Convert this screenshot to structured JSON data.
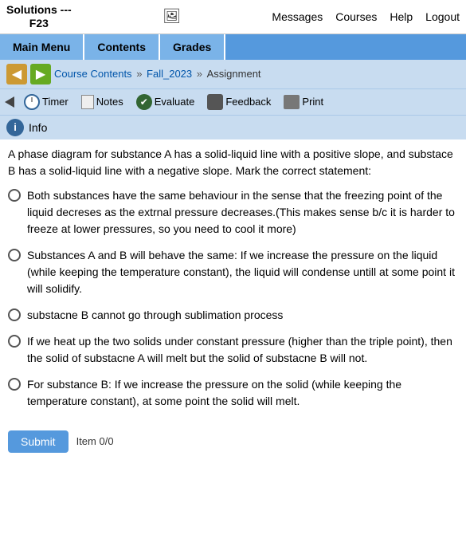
{
  "topnav": {
    "logo": "Solutions ---\nF23",
    "links": [
      "Messages",
      "Courses",
      "Help",
      "Logout"
    ]
  },
  "menubar": {
    "items": [
      "Main Menu",
      "Contents",
      "Grades"
    ]
  },
  "breadcrumb": {
    "back_label": "◄",
    "fwd_label": "►",
    "parts": [
      "Course Contents",
      "Fall_2023",
      "Assignment"
    ],
    "separators": [
      "»",
      "»"
    ]
  },
  "toolbar": {
    "triangle": "◄",
    "timer_label": "Timer",
    "notes_label": "Notes",
    "evaluate_label": "Evaluate",
    "feedback_label": "Feedback",
    "print_label": "Print"
  },
  "info": {
    "label": "Info"
  },
  "question": {
    "text": "A phase diagram for substance A has a solid-liquid line with a positive slope, and substace B has a solid-liquid line with a negative slope. Mark the correct statement:",
    "options": [
      "Both substances have the same behaviour in the sense that the freezing point of the liquid decreses as the extrnal pressure decreases.(This makes sense b/c it is harder to freeze at lower pressures, so you need to cool it more)",
      "Substances A and B will behave the same: If we increase the pressure on the liquid (while keeping the temperature constant), the liquid will condense untill at some point it will solidify.",
      "substacne B cannot go through sublimation process",
      "If we heat up the two solids under constant pressure (higher than the triple point), then the solid of substacne A will melt but the solid of substacne B will not.",
      "For substance B: If we increase the pressure on the solid (while keeping the temperature constant), at some point the solid will melt."
    ]
  },
  "bottom": {
    "submit_label": "Submit",
    "page_label": "Item 0/0"
  }
}
